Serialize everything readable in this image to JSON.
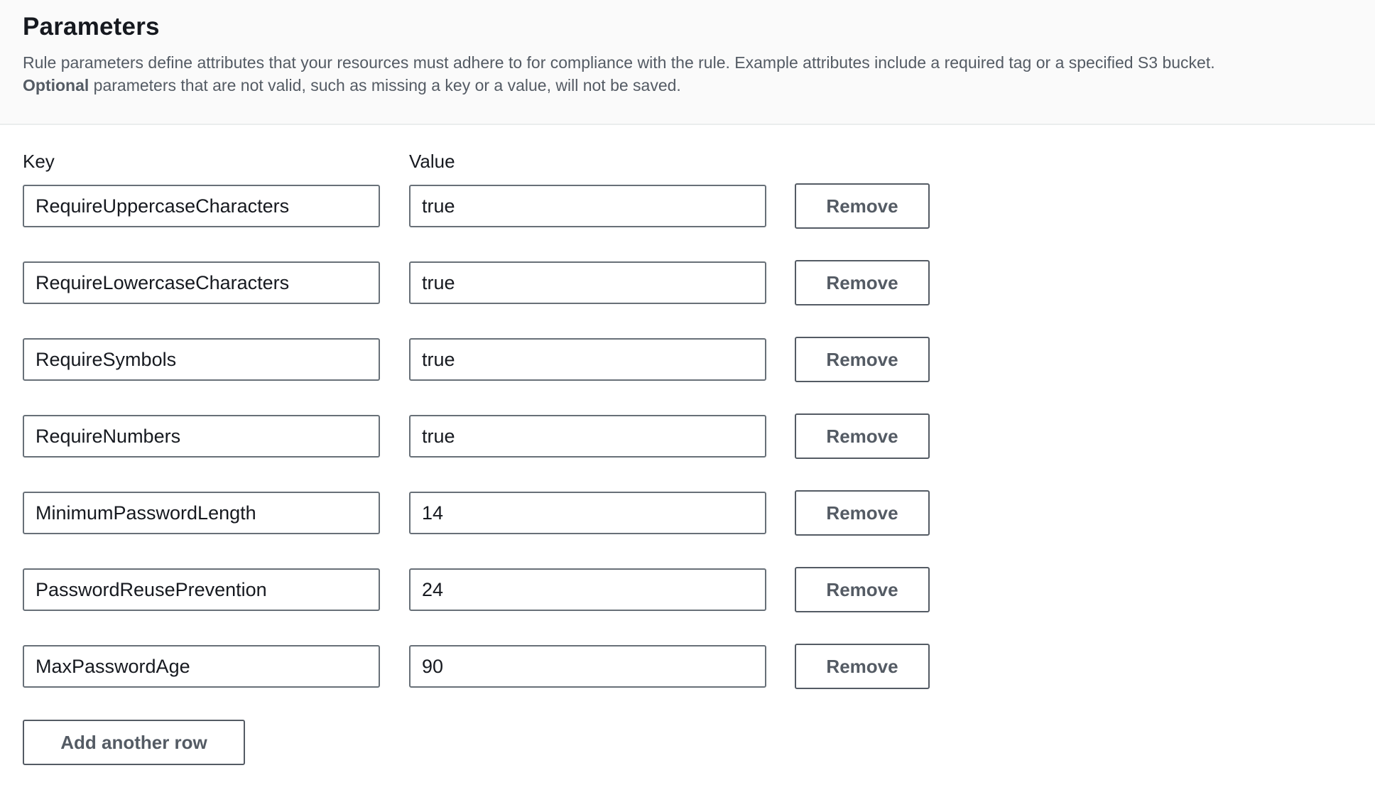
{
  "header": {
    "title": "Parameters",
    "description_line1": "Rule parameters define attributes that your resources must adhere to for compliance with the rule. Example attributes include a required tag or a specified S3 bucket.",
    "description_optional_bold": "Optional",
    "description_line2_rest": " parameters that are not valid, such as missing a key or a value, will not be saved."
  },
  "columns": {
    "key_label": "Key",
    "value_label": "Value"
  },
  "rows": [
    {
      "key": "RequireUppercaseCharacters",
      "value": "true",
      "remove_label": "Remove"
    },
    {
      "key": "RequireLowercaseCharacters",
      "value": "true",
      "remove_label": "Remove"
    },
    {
      "key": "RequireSymbols",
      "value": "true",
      "remove_label": "Remove"
    },
    {
      "key": "RequireNumbers",
      "value": "true",
      "remove_label": "Remove"
    },
    {
      "key": "MinimumPasswordLength",
      "value": "14",
      "remove_label": "Remove"
    },
    {
      "key": "PasswordReusePrevention",
      "value": "24",
      "remove_label": "Remove"
    },
    {
      "key": "MaxPasswordAge",
      "value": "90",
      "remove_label": "Remove"
    }
  ],
  "actions": {
    "add_row_label": "Add another row"
  },
  "colors": {
    "header_background": "#fafafa",
    "text_primary": "#16191f",
    "text_secondary": "#545b64",
    "input_border": "#687078"
  }
}
